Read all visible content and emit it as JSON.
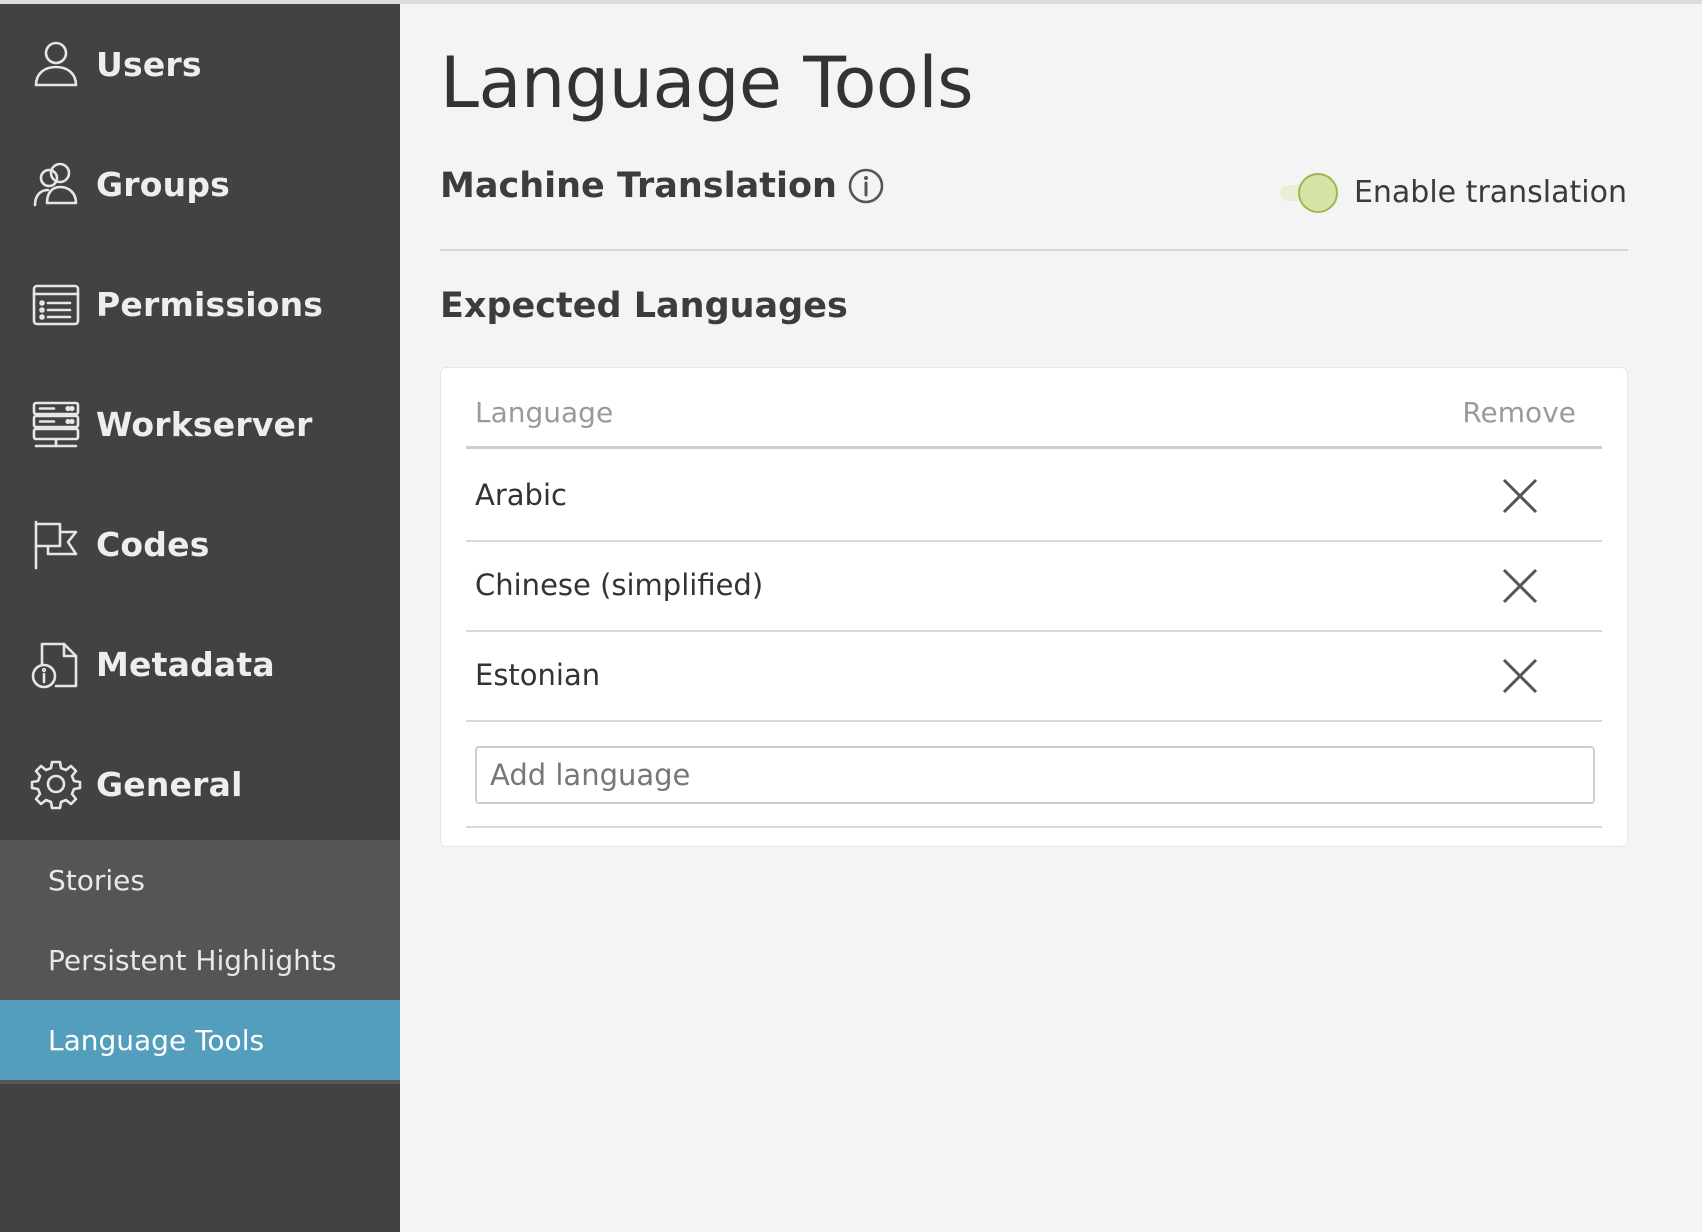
{
  "page": {
    "title": "Language Tools"
  },
  "sidebar": {
    "items": [
      {
        "label": "Users",
        "icon": "user-icon"
      },
      {
        "label": "Groups",
        "icon": "group-icon"
      },
      {
        "label": "Permissions",
        "icon": "permissions-icon"
      },
      {
        "label": "Workserver",
        "icon": "server-icon"
      },
      {
        "label": "Codes",
        "icon": "flag-icon"
      },
      {
        "label": "Metadata",
        "icon": "document-info-icon"
      },
      {
        "label": "General",
        "icon": "gear-icon"
      }
    ],
    "sub_items": [
      {
        "label": "Stories",
        "active": false
      },
      {
        "label": "Persistent Highlights",
        "active": false
      },
      {
        "label": "Language Tools",
        "active": true
      }
    ]
  },
  "machine_translation": {
    "title": "Machine Translation",
    "info_icon": "info-icon",
    "toggle_label": "Enable translation",
    "enabled": true
  },
  "expected_languages": {
    "title": "Expected Languages",
    "columns": {
      "language": "Language",
      "remove": "Remove"
    },
    "rows": [
      {
        "language": "Arabic"
      },
      {
        "language": "Chinese (simplified)"
      },
      {
        "language": "Estonian"
      }
    ],
    "add_placeholder": "Add language",
    "add_value": ""
  },
  "colors": {
    "sidebar_bg": "#424242",
    "sub_nav_bg": "#555555",
    "active_accent": "#549ebd",
    "toggle_knob": "#d5e4a4",
    "page_bg": "#f4f4f4"
  }
}
